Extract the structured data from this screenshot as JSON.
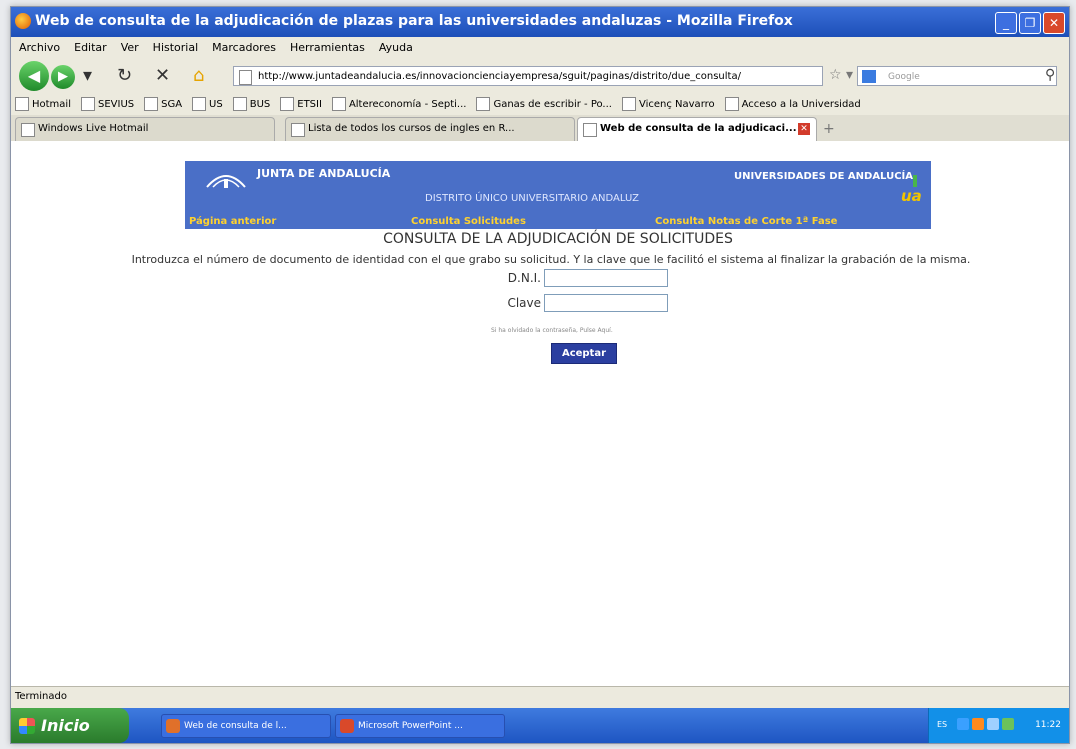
{
  "window": {
    "title": "Web de consulta de la adjudicación de plazas para las universidades andaluzas - Mozilla Firefox"
  },
  "menu": [
    "Archivo",
    "Editar",
    "Ver",
    "Historial",
    "Marcadores",
    "Herramientas",
    "Ayuda"
  ],
  "address": {
    "url": "http://www.juntadeandalucia.es/innovacioncienciayempresa/sguit/paginas/distrito/due_consulta/"
  },
  "search": {
    "placeholder": "Google"
  },
  "bookmarks": [
    "Hotmail",
    "SEVIUS",
    "SGA",
    "US",
    "BUS",
    "ETSII",
    "Altereconomía - Septi...",
    "Ganas de escribir - Po...",
    "Vicenç Navarro",
    "Acceso a la Universidad"
  ],
  "tabs": [
    {
      "label": "Windows Live Hotmail",
      "active": false
    },
    {
      "label": "Lista de todos los cursos de ingles en R...",
      "active": false
    },
    {
      "label": "Web de consulta de la adjudicaci...",
      "active": true
    }
  ],
  "banner": {
    "org": "JUNTA DE ANDALUCÍA",
    "univ": "UNIVERSIDADES DE ANDALUCÍA",
    "distrito": "DISTRITO ÚNICO UNIVERSITARIO ANDALUZ",
    "ua": "ua",
    "nav": [
      "Página anterior",
      "Consulta Solicitudes",
      "Consulta Notas de Corte 1ª Fase"
    ]
  },
  "page": {
    "heading": "CONSULTA DE LA ADJUDICACIÓN DE SOLICITUDES",
    "instructions": "Introduzca el número de documento de identidad con el que grabo su solicitud. Y la clave que le facilitó el sistema al finalizar la grabación de la misma.",
    "dni_label": "D.N.I.",
    "clave_label": "Clave",
    "forgot": "Si ha olvidado la contraseña, Pulse Aquí.",
    "submit": "Aceptar"
  },
  "status": {
    "text": "Terminado"
  },
  "taskbar": {
    "start": "Inicio",
    "tasks": [
      "Web de consulta de l...",
      "Microsoft PowerPoint ..."
    ],
    "lang": "ES",
    "time": "11:22"
  },
  "colors": {
    "banner": "#4a6fc7",
    "nav_text": "#ffd22e",
    "button": "#2b3fa0"
  }
}
